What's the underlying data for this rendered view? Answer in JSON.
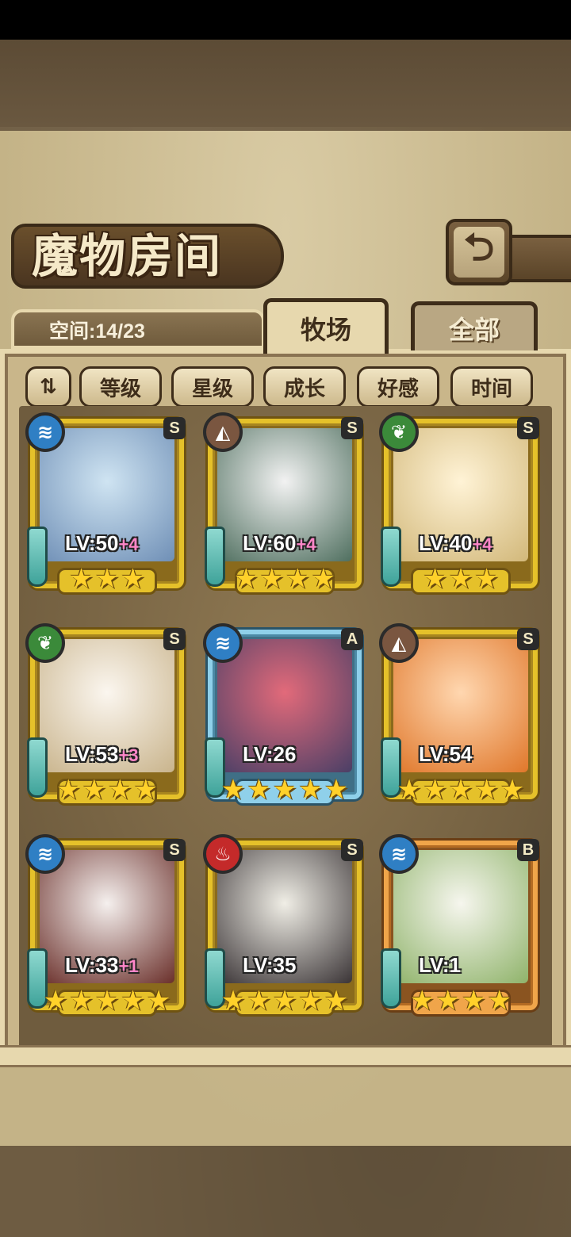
{
  "screen": {
    "title": "魔物房间",
    "space_label": "空间:14/23"
  },
  "tabs": [
    {
      "label": "牧场",
      "active": true
    },
    {
      "label": "全部",
      "active": false
    }
  ],
  "sort": {
    "toggle_icon": "⇅",
    "buttons": [
      "等级",
      "星级",
      "成长",
      "好感",
      "时间"
    ]
  },
  "monsters": [
    {
      "element": "water",
      "rank": "S",
      "level": "LV:50",
      "bonus": "+4",
      "stars": 3,
      "frame": "gold"
    },
    {
      "element": "earth",
      "rank": "S",
      "level": "LV:60",
      "bonus": "+4",
      "stars": 4,
      "frame": "gold"
    },
    {
      "element": "nature",
      "rank": "S",
      "level": "LV:40",
      "bonus": "+4",
      "stars": 3,
      "frame": "gold"
    },
    {
      "element": "nature",
      "rank": "S",
      "level": "LV:53",
      "bonus": "+3",
      "stars": 4,
      "frame": "gold"
    },
    {
      "element": "water",
      "rank": "A",
      "level": "LV:26",
      "bonus": "",
      "stars": 5,
      "frame": "blue"
    },
    {
      "element": "earth",
      "rank": "S",
      "level": "LV:54",
      "bonus": "",
      "stars": 5,
      "frame": "gold"
    },
    {
      "element": "water",
      "rank": "S",
      "level": "LV:33",
      "bonus": "+1",
      "stars": 5,
      "frame": "gold"
    },
    {
      "element": "fire",
      "rank": "S",
      "level": "LV:35",
      "bonus": "",
      "stars": 5,
      "frame": "gold"
    },
    {
      "element": "water",
      "rank": "B",
      "level": "LV:1",
      "bonus": "",
      "stars": 4,
      "frame": "orange"
    }
  ],
  "colors": {
    "gold_frame": "#e5c12a",
    "blue_frame": "#8fd0ea",
    "orange_frame": "#f0a54a",
    "bonus_text": "#ff86c8"
  }
}
